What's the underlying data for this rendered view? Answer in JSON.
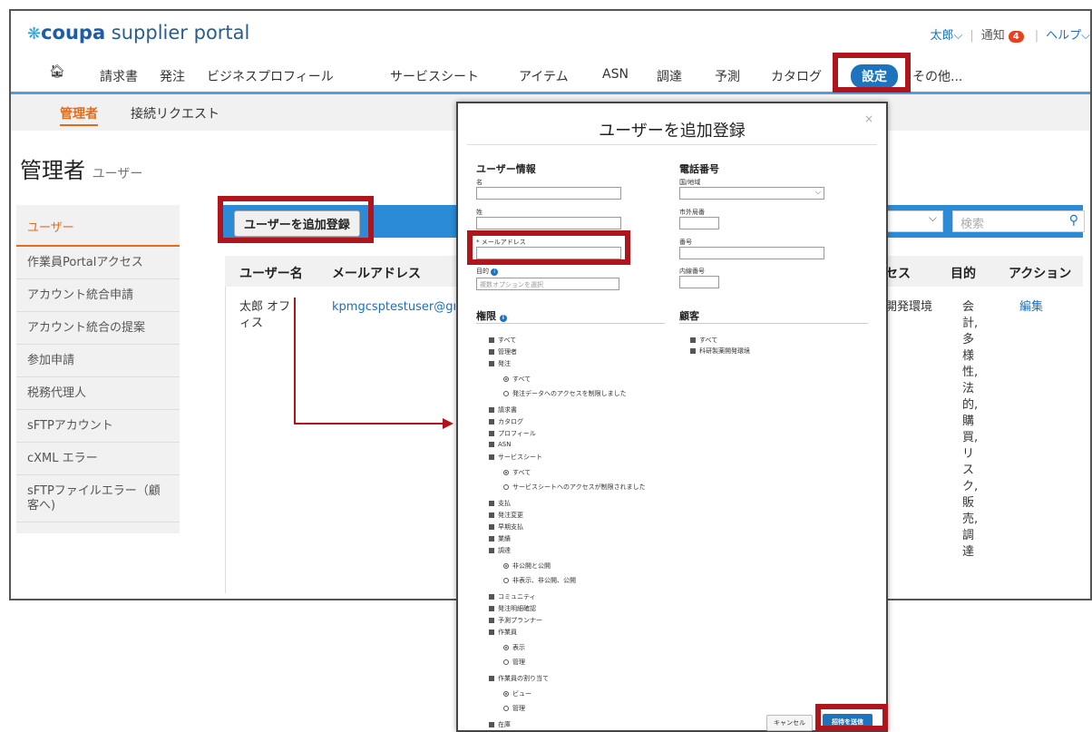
{
  "brand": {
    "logo_icon": "coupa-star-icon",
    "logo_bold": "coupa",
    "logo_rest": " supplier portal"
  },
  "topright": {
    "user": "太郎⌵",
    "notify_label": "通知",
    "notify_count": "4",
    "help": "ヘルプ⌵"
  },
  "nav": [
    "請求書",
    "発注",
    "ビジネスプロフィール",
    "サービスシート",
    "アイテム",
    "ASN",
    "調達",
    "予測",
    "カタログ",
    "設定",
    "その他..."
  ],
  "subnav": {
    "admin": "管理者",
    "requests": "接続リクエスト"
  },
  "page": {
    "title": "管理者",
    "subtitle": "ユーザー"
  },
  "sidebar": [
    "ユーザー",
    "作業員Portalアクセス",
    "アカウント統合申請",
    "アカウント統合の提案",
    "参加申請",
    "税務代理人",
    "sFTPアカウント",
    "cXML エラー",
    "sFTPファイルエラー（顧客へ)"
  ],
  "toolbar": {
    "add_user": "ユーザーを追加登録",
    "search_placeholder": "検索"
  },
  "table": {
    "headers": {
      "username": "ユーザー名",
      "email": "メールアドレス",
      "access": "セス",
      "purpose": "目的",
      "action": "アクション"
    },
    "row": {
      "username": "太郎 オフィス",
      "email": "kpmgcsptestuser@gma",
      "access": "開発環境",
      "purpose": "会計,多様性,法的,購買,リスク,販売,調達",
      "action": "編集"
    }
  },
  "modal": {
    "title": "ユーザーを追加登録",
    "close": "×",
    "user_info": "ユーザー情報",
    "first_name": "名",
    "last_name": "姓",
    "email_label": "* メールアドレス",
    "purpose_label": "目的",
    "purpose_placeholder": "複数オプションを選択",
    "phone": "電話番号",
    "country": "国/地域",
    "area": "市外局番",
    "number": "番号",
    "ext": "内線番号",
    "perm_title": "権限",
    "customer_title": "顧客",
    "permissions": [
      {
        "t": "cb",
        "l": "すべて"
      },
      {
        "t": "cb",
        "l": "管理者"
      },
      {
        "t": "cb",
        "l": "発注"
      },
      {
        "t": "rb1",
        "l": "すべて"
      },
      {
        "t": "rb0",
        "l": "発注データへのアクセスを制限しました"
      },
      {
        "t": "cb",
        "l": "請求書"
      },
      {
        "t": "cb",
        "l": "カタログ"
      },
      {
        "t": "cb",
        "l": "プロフィール"
      },
      {
        "t": "cb",
        "l": "ASN"
      },
      {
        "t": "cb",
        "l": "サービスシート"
      },
      {
        "t": "rb1",
        "l": "すべて"
      },
      {
        "t": "rb0",
        "l": "サービスシートへのアクセスが制限されました"
      },
      {
        "t": "cb",
        "l": "支払"
      },
      {
        "t": "cb",
        "l": "発注変更"
      },
      {
        "t": "cb",
        "l": "早期支払"
      },
      {
        "t": "cb",
        "l": "業績"
      },
      {
        "t": "cb",
        "l": "調達"
      },
      {
        "t": "rb1",
        "l": "非公開と公開"
      },
      {
        "t": "rb0",
        "l": "非表示、非公開、公開"
      },
      {
        "t": "cb",
        "l": "コミュニティ"
      },
      {
        "t": "cb",
        "l": "発注明細確認"
      },
      {
        "t": "cb",
        "l": "予測プランナー"
      },
      {
        "t": "cb",
        "l": "作業員"
      },
      {
        "t": "rb1",
        "l": "表示"
      },
      {
        "t": "rb0",
        "l": "管理"
      },
      {
        "t": "cb",
        "l": "作業員の割り当て"
      },
      {
        "t": "rb1",
        "l": "ビュー"
      },
      {
        "t": "rb0",
        "l": "管理"
      },
      {
        "t": "cb",
        "l": "在庫"
      }
    ],
    "customers": [
      "すべて",
      "科研製薬開発環境"
    ],
    "cancel": "キャンセル",
    "send": "招待を送信"
  }
}
